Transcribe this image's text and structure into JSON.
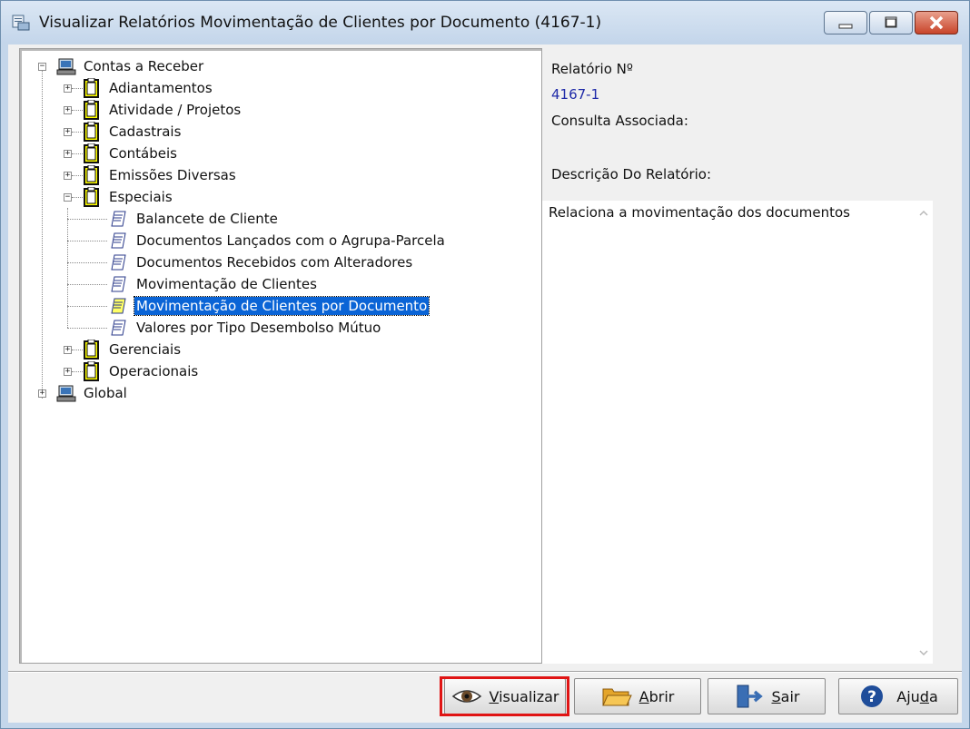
{
  "window": {
    "title": "Visualizar Relatórios Movimentação de Clientes por Documento (4167-1)"
  },
  "tree": {
    "root1": "Contas a Receber",
    "groups": [
      "Adiantamentos",
      "Atividade / Projetos",
      "Cadastrais",
      "Contábeis",
      "Emissões Diversas",
      "Especiais"
    ],
    "especiais_items": [
      "Balancete de Cliente",
      "Documentos Lançados com o Agrupa-Parcela",
      "Documentos Recebidos com Alteradores",
      "Movimentação de Clientes",
      "Movimentação de Clientes por Documento",
      "Valores por Tipo Desembolso Mútuo"
    ],
    "groups_after": [
      "Gerenciais",
      "Operacionais"
    ],
    "root2": "Global",
    "selected": "Movimentação de Clientes por Documento"
  },
  "details": {
    "report_no_label": "Relatório Nº",
    "report_no_value": "4167-1",
    "query_label": "Consulta Associada:",
    "description_label": "Descrição Do Relatório:",
    "description_text": "Relaciona a movimentação dos documentos"
  },
  "buttons": {
    "view_pre": "",
    "view_u": "V",
    "view_post": "isualizar",
    "open_u": "A",
    "open_post": "brir",
    "exit_u": "S",
    "exit_post": "air",
    "help_pre": "Aju",
    "help_u": "d",
    "help_post": "a"
  },
  "colors": {
    "selection": "#0a64d6",
    "highlight_border": "#e01414",
    "value_text": "#1f2aa8"
  }
}
